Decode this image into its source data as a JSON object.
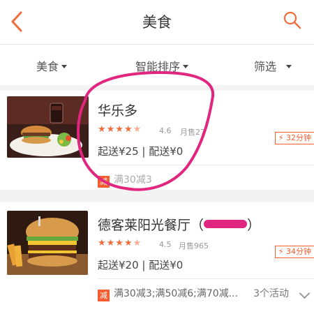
{
  "header": {
    "title": "美食",
    "back_icon": "chevron-left-icon",
    "search_icon": "search-icon",
    "accent": "#f26d3d"
  },
  "filters": [
    {
      "label": "美食"
    },
    {
      "label": "智能排序"
    },
    {
      "label": "筛选"
    }
  ],
  "restaurants": [
    {
      "name": "华乐多",
      "rating": "4.6",
      "monthly_sales": "月售27",
      "fees": "起送¥25 | 配送¥0",
      "time_tag": "⚡ 32分钟",
      "promo_badge": "减",
      "promo_text": "满30减3"
    },
    {
      "name": "德客莱阳光餐厅（",
      "name_suffix": "）",
      "rating": "4.5",
      "monthly_sales": "月售965",
      "fees": "起送¥20 | 配送¥0",
      "time_tag": "⚡ 34分钟",
      "promo_badge": "减",
      "promo_text": "满30减3;满50减6;满70减...",
      "activity_count": "3个活动"
    }
  ],
  "colors": {
    "star": "#f26d3d",
    "promo": "#f55b2f",
    "annotation": "#e0267f"
  }
}
